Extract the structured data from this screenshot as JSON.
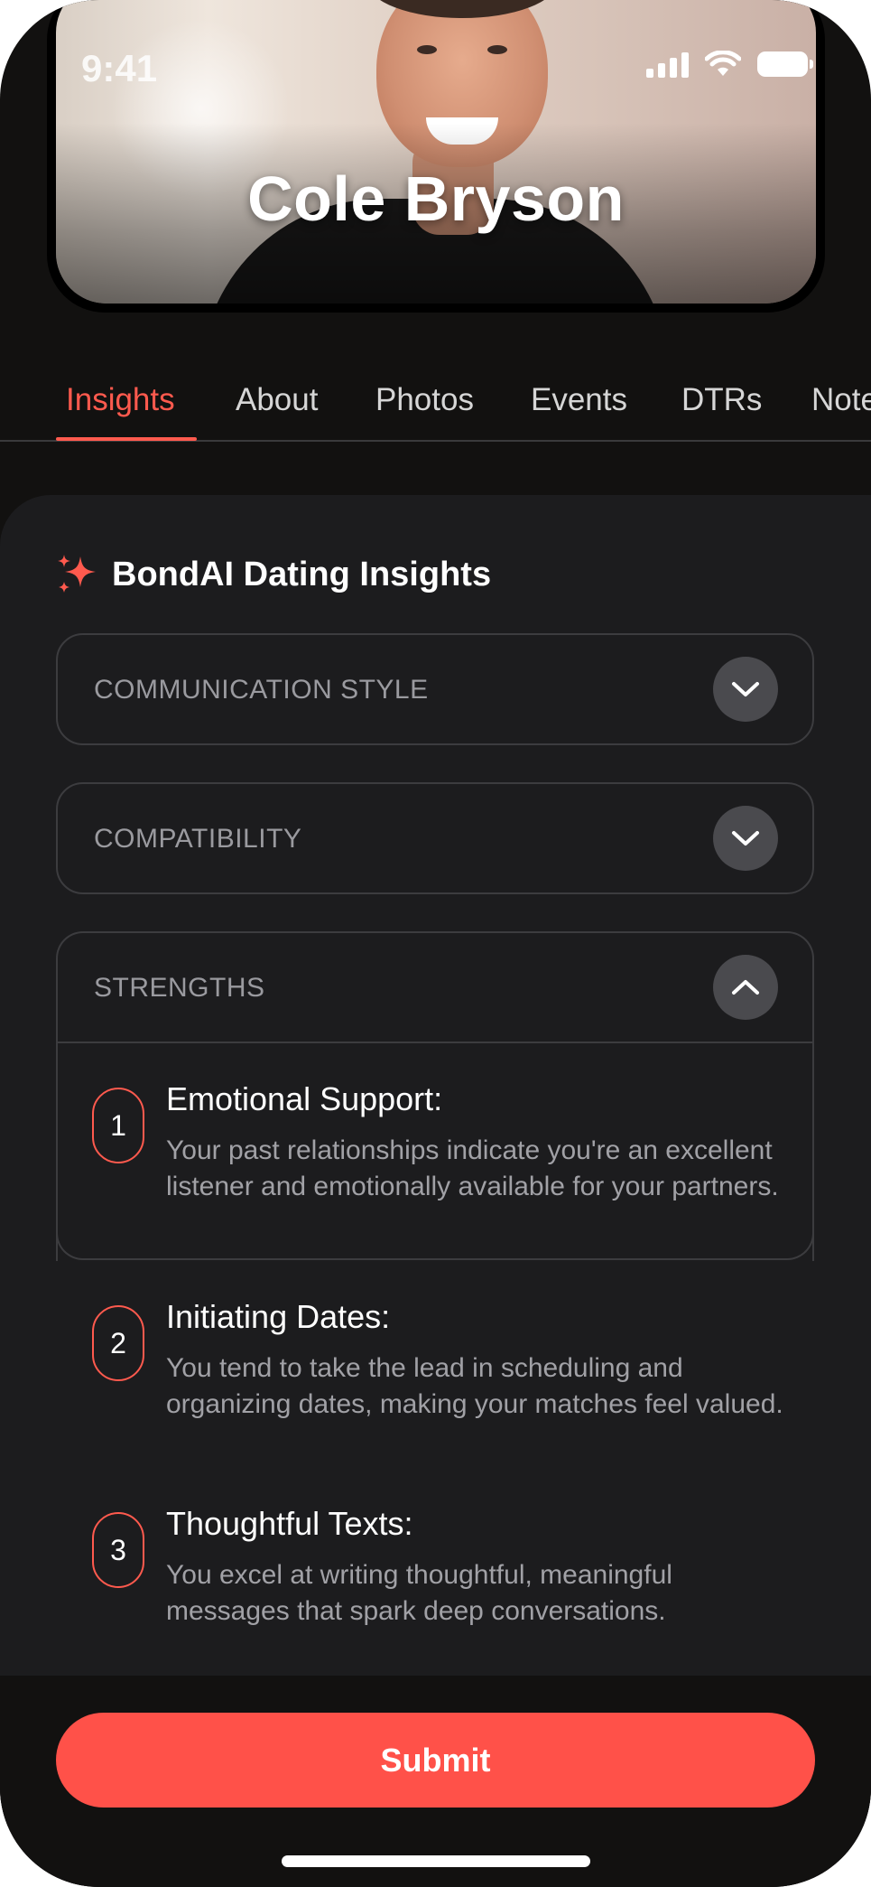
{
  "status_bar": {
    "time": "9:41"
  },
  "profile": {
    "name": "Cole Bryson"
  },
  "tabs": [
    {
      "label": "Insights",
      "active": true
    },
    {
      "label": "About",
      "active": false
    },
    {
      "label": "Photos",
      "active": false
    },
    {
      "label": "Events",
      "active": false
    },
    {
      "label": "DTRs",
      "active": false
    },
    {
      "label": "Notes",
      "active": false
    }
  ],
  "insights": {
    "title": "BondAI Dating Insights",
    "icon": "sparkles-icon",
    "accent_color": "#ff5a4e",
    "sections": [
      {
        "label": "COMMUNICATION STYLE",
        "expanded": false
      },
      {
        "label": "COMPATIBILITY",
        "expanded": false
      },
      {
        "label": "STRENGTHS",
        "expanded": true,
        "items": [
          {
            "number": "1",
            "title": "Emotional Support:",
            "description": "Your past relationships indicate you're an excellent listener and emotionally available for your partners."
          },
          {
            "number": "2",
            "title": "Initiating Dates:",
            "description": "You tend to take the lead in scheduling and organizing dates, making your matches feel valued."
          },
          {
            "number": "3",
            "title": "Thoughtful Texts:",
            "description": "You excel at writing thoughtful, meaningful messages that spark deep conversations."
          }
        ]
      }
    ]
  },
  "footer": {
    "submit_label": "Submit",
    "button_color": "#ff5149"
  }
}
